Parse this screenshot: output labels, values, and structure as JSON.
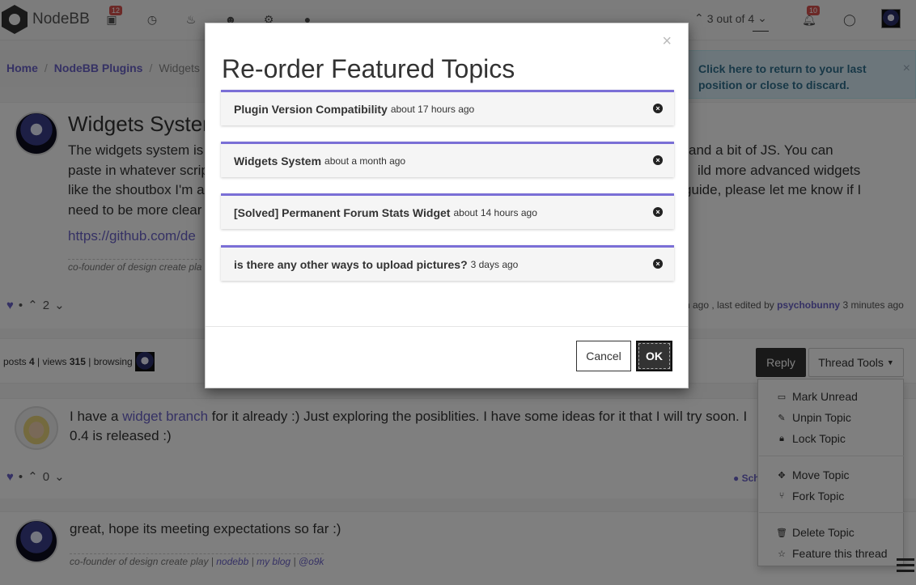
{
  "navbar": {
    "brand": "NodeBB",
    "notifications_unread": "12",
    "alerts_count": "10",
    "pagination": "3 out of 4"
  },
  "breadcrumb": {
    "items": [
      "Home",
      "NodeBB Plugins",
      "Widgets"
    ]
  },
  "return_banner": {
    "text": "Click here to return to your last position or close to discard.",
    "close": "×"
  },
  "main_post": {
    "title": "Widgets System",
    "body": "The widgets system is … and a bit of JS. You can paste in whatever scrip… build more advanced widgets like the shoutbox I'm a… guide, please let me know if I need to be more clear",
    "body_lines": [
      "The widgets system is",
      "paste in whatever scrip",
      "like the shoutbox I'm a",
      "need to be more clear"
    ],
    "body_lines_right": [
      "and a bit of JS. You can",
      "ild more advanced widgets",
      "guide, please let me know if I",
      ""
    ],
    "link": "https://github.com/de",
    "signature": "co-founder of design create pla",
    "votes": "2",
    "edit_meta_prefix": "h ago , last edited by",
    "edit_meta_user": "psychobunny",
    "edit_meta_suffix": "3 minutes ago"
  },
  "topic_bar": {
    "posts_label": "posts",
    "posts": "4",
    "views_label": "views",
    "views": "315",
    "browsing_label": "browsing",
    "reply_label": "Reply",
    "thread_tools_label": "Thread Tools"
  },
  "thread_tools": {
    "group1": [
      {
        "icon": "inbox-icon",
        "glyph": "▭",
        "label": "Mark Unread"
      },
      {
        "icon": "pin-icon",
        "glyph": "✎",
        "label": "Unpin Topic"
      },
      {
        "icon": "lock-icon",
        "glyph": "🔒︎",
        "label": "Lock Topic"
      }
    ],
    "group2": [
      {
        "icon": "move-icon",
        "glyph": "✥",
        "label": "Move Topic"
      },
      {
        "icon": "fork-icon",
        "glyph": "⑂",
        "label": "Fork Topic"
      }
    ],
    "group3": [
      {
        "icon": "trash-icon",
        "glyph": "🗑︎",
        "label": "Delete Topic"
      },
      {
        "icon": "star-icon",
        "glyph": "☆",
        "label": "Feature this thread"
      }
    ]
  },
  "reply1": {
    "text_before": "I have a ",
    "link": "widget branch",
    "text_after": " for it already :) Just exploring the posiblities. I have some ideas for it that I will try soon. I",
    "line2": "0.4 is released :)",
    "votes": "0",
    "tag": "Sch"
  },
  "reply2": {
    "text": "great, hope its meeting expectations so far :)",
    "sig_prefix": "co-founder of design create play |",
    "sig_links": [
      "nodebb",
      "my blog",
      "@o9k"
    ]
  },
  "modal": {
    "title": "Re-order Featured Topics",
    "close": "×",
    "topics": [
      {
        "title": "Plugin Version Compatibility",
        "ago": "about 17 hours ago"
      },
      {
        "title": "Widgets System",
        "ago": "about a month ago"
      },
      {
        "title": "[Solved] Permanent Forum Stats Widget",
        "ago": "about 14 hours ago"
      },
      {
        "title": "is there any other ways to upload pictures?",
        "ago": "3 days ago"
      }
    ],
    "cancel_label": "Cancel",
    "ok_label": "OK"
  },
  "colors": {
    "accent": "#6b62c9",
    "topic_border": "#7a6fd6",
    "badge": "#d9534f"
  }
}
